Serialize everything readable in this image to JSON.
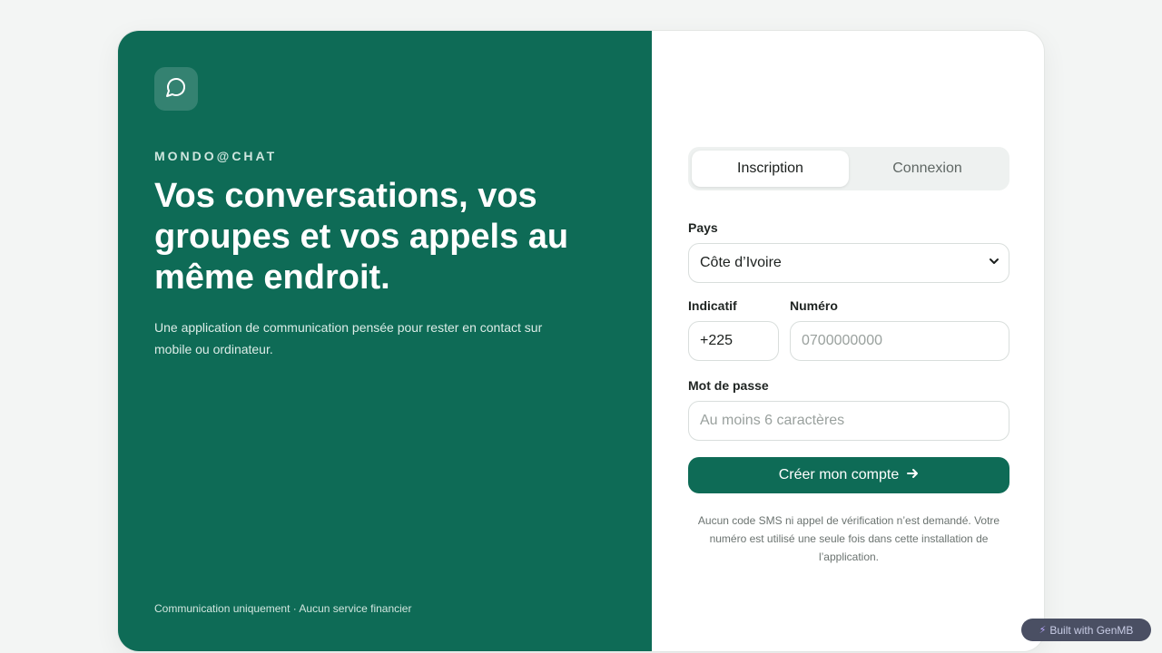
{
  "brand": {
    "logo_icon": "chat-bubble-icon",
    "name": "MONDO@CHAT",
    "headline": "Vos conversations, vos groupes et vos appels au même endroit.",
    "lead": "Une application de communication pensée pour rester en contact sur mobile ou ordinateur.",
    "footer": "Communication uniquement · Aucun service financier"
  },
  "tabs": [
    {
      "label": "Inscription",
      "active": true
    },
    {
      "label": "Connexion",
      "active": false
    }
  ],
  "form": {
    "country_label": "Pays",
    "country_value": "Côte d’Ivoire",
    "dial_label": "Indicatif",
    "dial_value": "+225",
    "number_label": "Numéro",
    "number_placeholder": "0700000000",
    "password_label": "Mot de passe",
    "password_placeholder": "Au moins 6 caractères",
    "submit_label": "Créer mon compte"
  },
  "disclaimer": "Aucun code SMS ni appel de vérification n’est demandé. Votre numéro est utilisé une seule fois dans cette installation de l’application.",
  "badge": {
    "label": "Built with GenMB",
    "icon": "lightning-icon"
  },
  "colors": {
    "brand_green": "#0e6b56",
    "page_bg": "#f3f5f4"
  }
}
